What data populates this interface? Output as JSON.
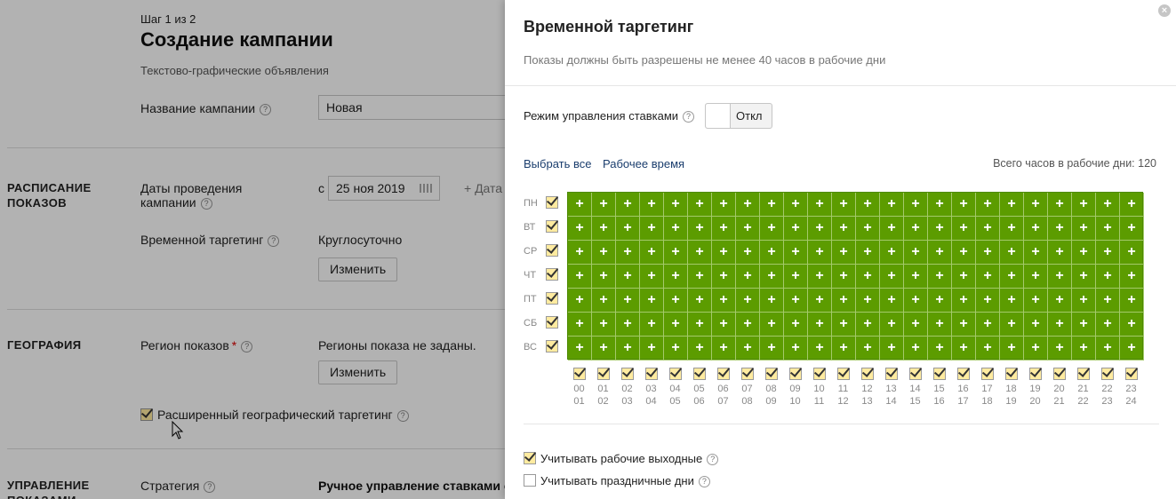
{
  "background": {
    "step": "Шаг 1 из 2",
    "title": "Создание кампании",
    "subtitle": "Текстово-графические объявления",
    "campaign_name_label": "Название кампании",
    "campaign_name_value": "Новая",
    "schedule_section": "РАСПИСАНИЕ ПОКАЗОВ",
    "dates_label": "Даты проведения кампании",
    "date_from_prefix": "с",
    "date_from_value": "25 ноя 2019",
    "date_add_label": "Дата",
    "time_targeting_label": "Временной таргетинг",
    "time_targeting_value": "Круглосуточно",
    "change_button": "Изменить",
    "geo_section": "ГЕОГРАФИЯ",
    "region_label": "Регион показов",
    "required_mark": "*",
    "region_value": "Регионы показа не заданы.",
    "extended_geo_label": "Расширенный географический таргетинг",
    "management_section": "УПРАВЛЕНИЕ ПОКАЗАМИ",
    "strategy_label": "Стратегия",
    "strategy_value": "Ручное управление ставками с оп"
  },
  "modal": {
    "title": "Временной таргетинг",
    "subtitle": "Показы должны быть разрешены не менее 40 часов в рабочие дни",
    "close_icon": "close-icon",
    "bid_mode_label": "Режим управления ставками",
    "bid_mode_toggle": "Откл",
    "select_all": "Выбрать все",
    "work_time": "Рабочее время",
    "total_hours": "Всего часов в рабочие дни: 120",
    "cell_symbol": "+",
    "days": [
      "ПН",
      "ВТ",
      "СР",
      "ЧТ",
      "ПТ",
      "СБ",
      "ВС"
    ],
    "hours_top": [
      "00",
      "01",
      "02",
      "03",
      "04",
      "05",
      "06",
      "07",
      "08",
      "09",
      "10",
      "11",
      "12",
      "13",
      "14",
      "15",
      "16",
      "17",
      "18",
      "19",
      "20",
      "21",
      "22",
      "23"
    ],
    "hours_bottom": [
      "01",
      "02",
      "03",
      "04",
      "05",
      "06",
      "07",
      "08",
      "09",
      "10",
      "11",
      "12",
      "13",
      "14",
      "15",
      "16",
      "17",
      "18",
      "19",
      "20",
      "21",
      "22",
      "23",
      "24"
    ],
    "consider_working_weekends": "Учитывать рабочие выходные",
    "consider_holidays": "Учитывать праздничные дни",
    "working_weekends_checked": true,
    "holidays_checked": false
  },
  "colors": {
    "grid_green": "#5c9c00",
    "checkbox_yellow": "#ffeba0",
    "link_blue": "#1a3d6d"
  }
}
